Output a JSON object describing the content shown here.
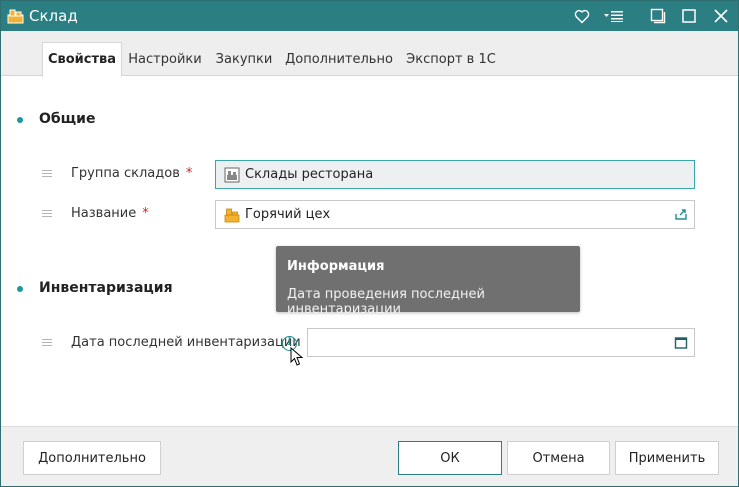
{
  "window": {
    "title": "Склад",
    "title_icon": "warehouse-icon",
    "controls": [
      "favorite-heart-icon",
      "menu-dropdown-icon",
      "restore-icon",
      "maximize-icon",
      "close-icon"
    ]
  },
  "tabs": [
    {
      "label": "Свойства",
      "active": true
    },
    {
      "label": "Настройки",
      "active": false
    },
    {
      "label": "Закупки",
      "active": false
    },
    {
      "label": "Дополнительно",
      "active": false
    },
    {
      "label": "Экспорт в 1С",
      "active": false
    }
  ],
  "sections": {
    "general": {
      "title": "Общие",
      "warehouse_group": {
        "label": "Группа складов",
        "required_mark": "*",
        "value": "Склады ресторана"
      },
      "name": {
        "label": "Название",
        "required_mark": "*",
        "value": "Горячий цех"
      }
    },
    "inventory": {
      "title": "Инвентаризация",
      "last_inventory_date": {
        "label": "Дата последней инвентаризации",
        "value": ""
      }
    }
  },
  "tooltip": {
    "title": "Информация",
    "body": "Дата проведения последней инвентаризации"
  },
  "footer": {
    "more_label": "Дополнительно",
    "ok_label": "ОК",
    "cancel_label": "Отмена",
    "apply_label": "Применить"
  },
  "colors": {
    "titlebar": "#2b7f83",
    "accent": "#1a9a9e",
    "required": "#d6202a",
    "tooltip_bg": "#707070"
  }
}
